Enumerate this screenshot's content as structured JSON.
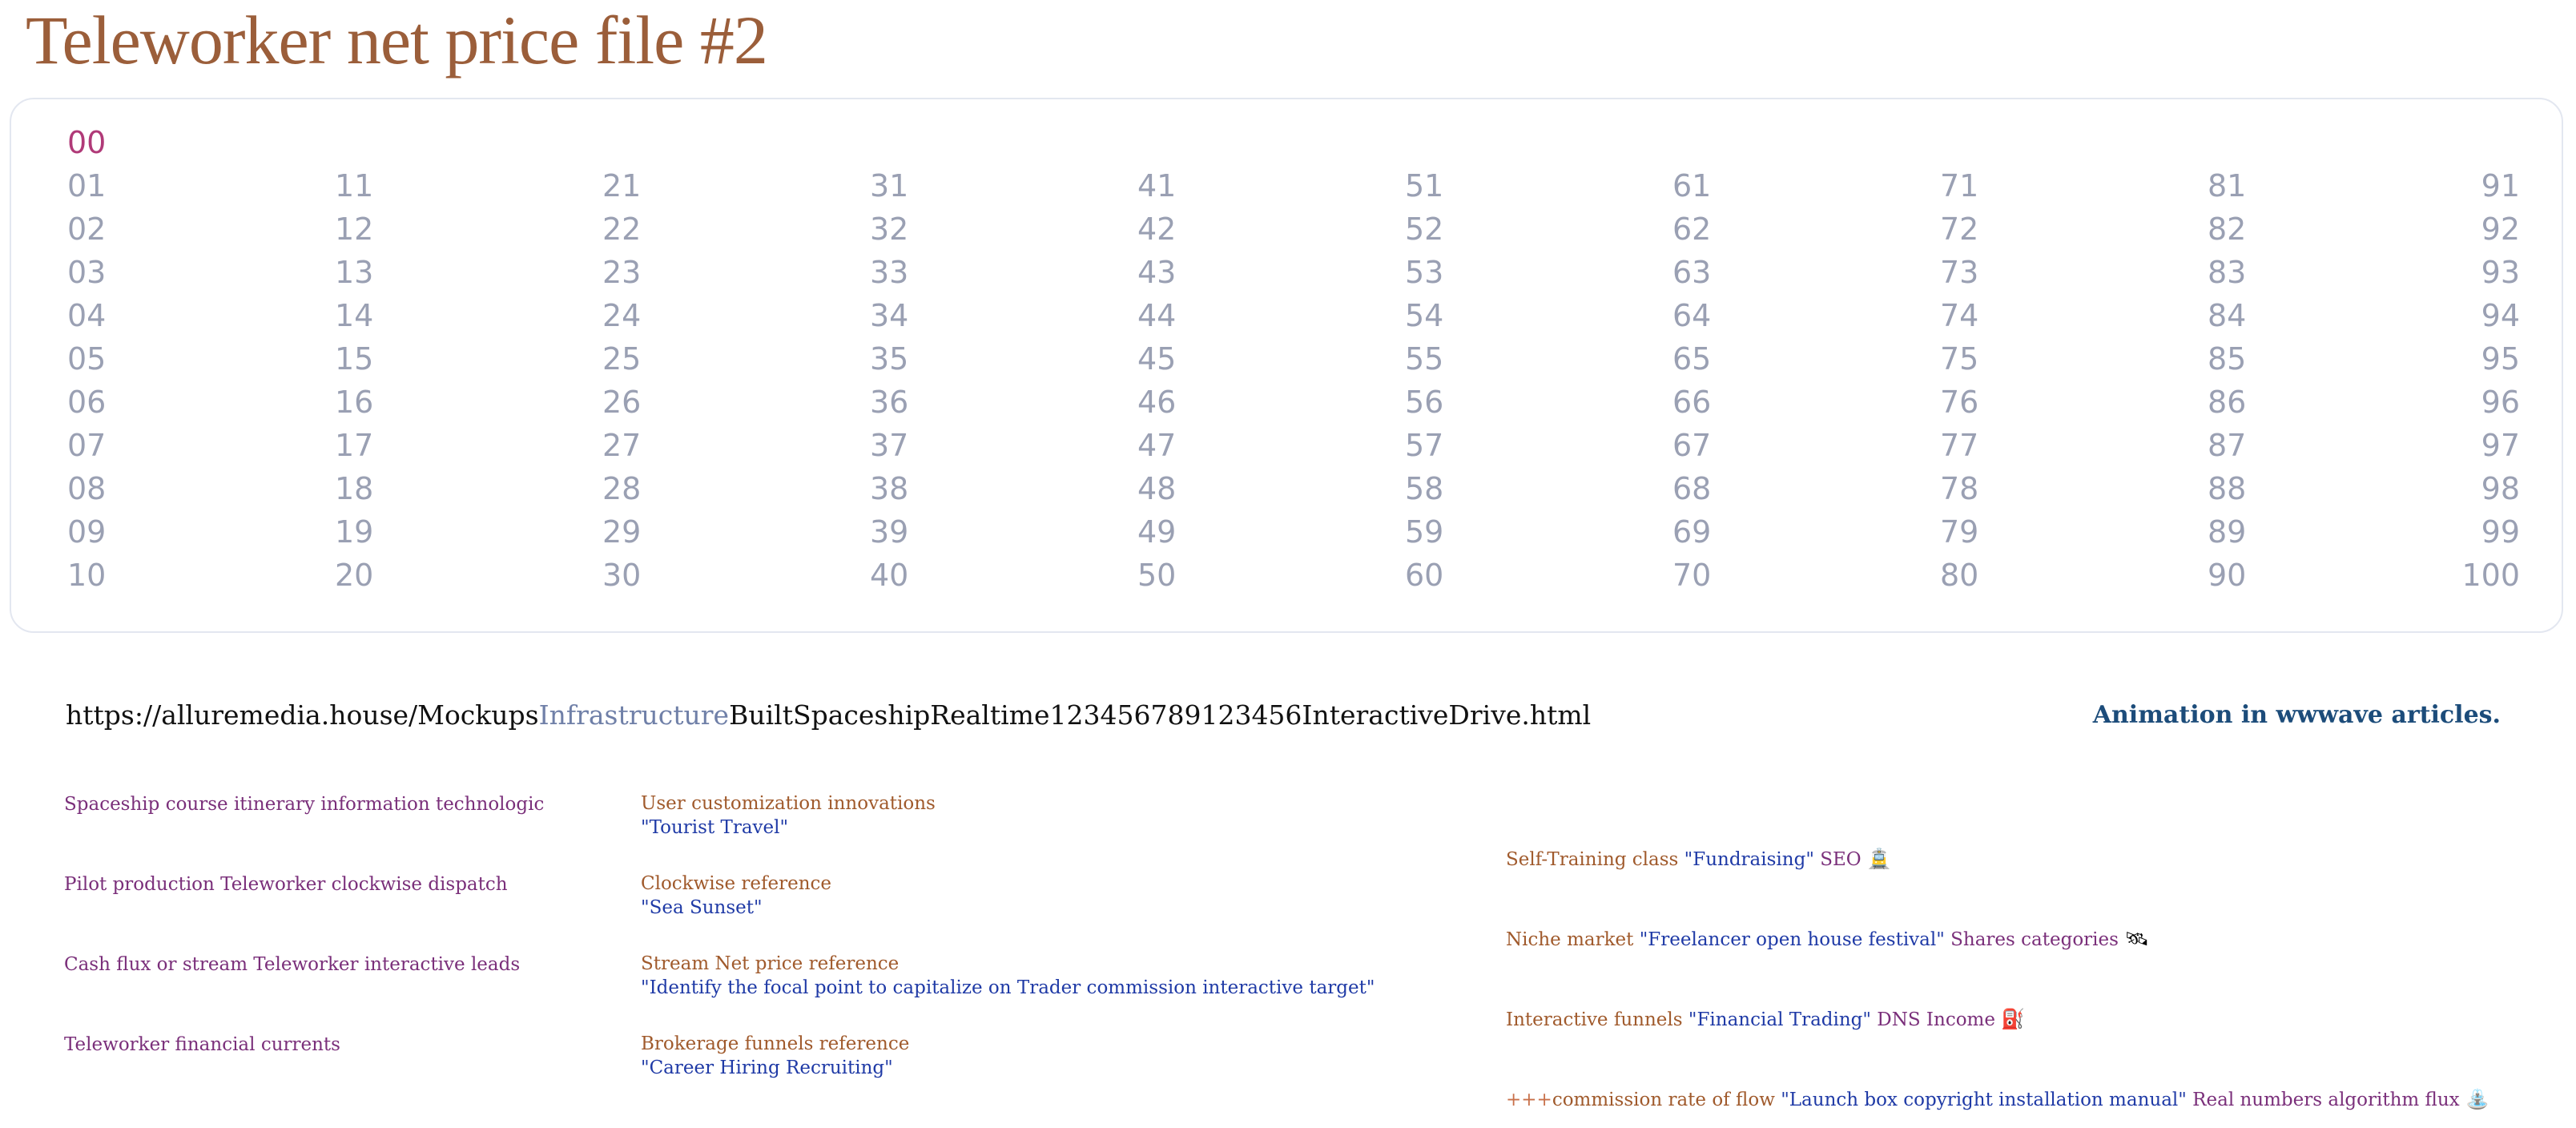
{
  "title": "Teleworker net price file #2",
  "grid": {
    "first": "00",
    "columns": [
      [
        "01",
        "02",
        "03",
        "04",
        "05",
        "06",
        "07",
        "08",
        "09",
        "10"
      ],
      [
        "11",
        "12",
        "13",
        "14",
        "15",
        "16",
        "17",
        "18",
        "19",
        "20"
      ],
      [
        "21",
        "22",
        "23",
        "24",
        "25",
        "26",
        "27",
        "28",
        "29",
        "30"
      ],
      [
        "31",
        "32",
        "33",
        "34",
        "35",
        "36",
        "37",
        "38",
        "39",
        "40"
      ],
      [
        "41",
        "42",
        "43",
        "44",
        "45",
        "46",
        "47",
        "48",
        "49",
        "50"
      ],
      [
        "51",
        "52",
        "53",
        "54",
        "55",
        "56",
        "57",
        "58",
        "59",
        "60"
      ],
      [
        "61",
        "62",
        "63",
        "64",
        "65",
        "66",
        "67",
        "68",
        "69",
        "70"
      ],
      [
        "71",
        "72",
        "73",
        "74",
        "75",
        "76",
        "77",
        "78",
        "79",
        "80"
      ],
      [
        "81",
        "82",
        "83",
        "84",
        "85",
        "86",
        "87",
        "88",
        "89",
        "90"
      ],
      [
        "91",
        "92",
        "93",
        "94",
        "95",
        "96",
        "97",
        "98",
        "99",
        "100"
      ]
    ]
  },
  "url": {
    "prefix": "https://alluremedia.house/Mockups",
    "mid": "Infrastructure",
    "suffix": "BuiltSpaceshipRealtime123456789123456InteractiveDrive.html"
  },
  "right_link": "Animation in wwwave articles.",
  "col1": [
    "Spaceship course itinerary information technologic",
    "Pilot production Teleworker clockwise dispatch",
    "Cash flux or stream Teleworker interactive leads",
    "Teleworker financial currents"
  ],
  "col2": [
    {
      "label": "User customization innovations",
      "quote": "\"Tourist Travel\""
    },
    {
      "label": "Clockwise reference",
      "quote": "\"Sea Sunset\""
    },
    {
      "label": "Stream Net price reference",
      "quote": "\"Identify the focal point to capitalize on Trader commission interactive target\""
    },
    {
      "label": "Brokerage funnels reference",
      "quote": "\"Career Hiring Recruiting\""
    }
  ],
  "col3": [
    {
      "a": "Self-Training class",
      "b": "\"Fundraising\"",
      "c": "SEO",
      "icon": "🚊"
    },
    {
      "a": "Niche market",
      "b": "\"Freelancer open house festival\"",
      "c": "Shares categories",
      "icon": "🛰"
    },
    {
      "a": "Interactive funnels",
      "b": "\"Financial Trading\"",
      "c": "DNS Income",
      "icon": "⛽"
    },
    {
      "pre": "+++",
      "a": "commission rate of flow",
      "b": "\"Launch box copyright installation manual\"",
      "c": "Real numbers algorithm flux",
      "icon": "⛲"
    }
  ]
}
